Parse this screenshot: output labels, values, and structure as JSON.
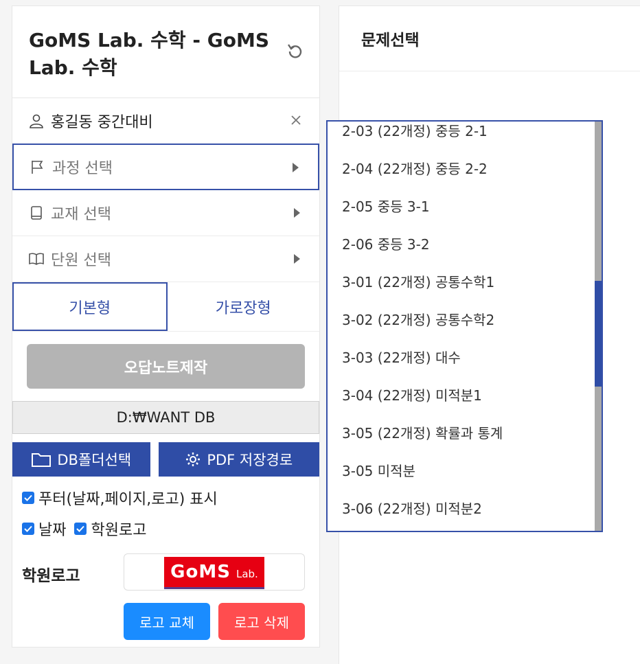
{
  "sidebar": {
    "title": "GoMS Lab. 수학 - GoMS Lab. 수학",
    "user": "홍길동 중간대비",
    "course_select": "과정 선택",
    "book_select": "교재 선택",
    "unit_select": "단원 선택",
    "tabs": [
      "기본형",
      "가로장형"
    ],
    "make_button": "오답노트제작",
    "db_path": "D:₩WANT DB",
    "db_folder_button": "DB폴더선택",
    "pdf_path_button": "PDF 저장경로",
    "footer_checkbox": "푸터(날짜,페이지,로고) 표시",
    "date_checkbox": "날짜",
    "logo_checkbox": "학원로고",
    "logo_label": "학원로고",
    "logo_text_main": "GoMS",
    "logo_text_sub": "Lab.",
    "replace_logo_button": "로고 교체",
    "delete_logo_button": "로고 삭제"
  },
  "main": {
    "header": "문제선택"
  },
  "dropdown": {
    "items": [
      "2-03 (22개정) 중등 2-1",
      "2-04 (22개정) 중등 2-2",
      "2-05 중등 3-1",
      "2-06 중등 3-2",
      "3-01 (22개정) 공통수학1",
      "3-02 (22개정) 공통수학2",
      "3-03 (22개정) 대수",
      "3-04 (22개정) 미적분1",
      "3-05 (22개정) 확률과 통계",
      "3-05 미적분",
      "3-06 (22개정) 미적분2"
    ]
  },
  "colors": {
    "accent": "#3650a8",
    "primary_blue": "#2f4da6",
    "disabled": "#b4b4b4",
    "replace": "#1a8cff",
    "delete": "#ff4d4f"
  }
}
